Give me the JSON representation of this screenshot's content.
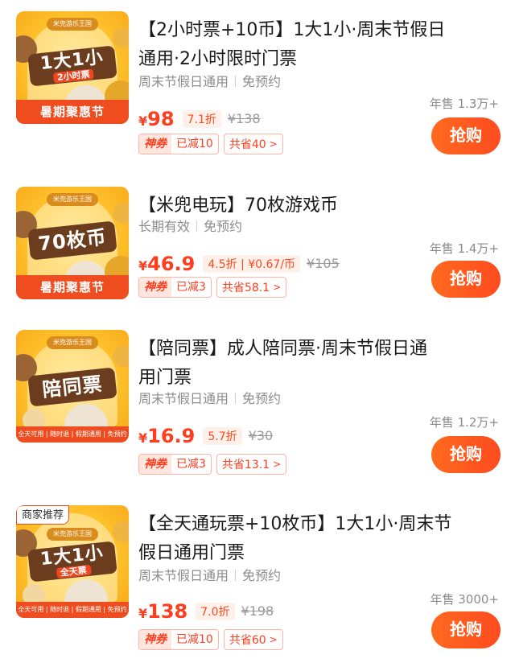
{
  "items": [
    {
      "thumb_park": "米兜游乐王国",
      "thumb_big": "1大1小",
      "thumb_sub": "2小时票",
      "thumb_ribbon": "暑期聚惠节",
      "title": "【2小时票+10币】1大1小·周末节假日\n通用·2小时限时门票",
      "validity": "周末节假日通用",
      "booking": "免预约",
      "currency": "¥",
      "price": "98",
      "discount": "7.1折",
      "original": "¥138",
      "coupon_tag": "神券",
      "coupon_amount": "已减10",
      "saving": "共省40",
      "sales": "年售 1.3万+",
      "buy": "抢购"
    },
    {
      "thumb_park": "米兜游乐王国",
      "thumb_big": "70枚币",
      "thumb_ribbon": "暑期聚惠节",
      "title": "【米兜电玩】70枚游戏币",
      "validity": "长期有效",
      "booking": "免预约",
      "currency": "¥",
      "price": "46.9",
      "discount": "4.5折 | ¥0.67/币",
      "original": "¥105",
      "coupon_tag": "神券",
      "coupon_amount": "已减3",
      "saving": "共省58.1",
      "sales": "年售 1.4万+",
      "buy": "抢购"
    },
    {
      "thumb_park": "米兜游乐王国",
      "thumb_big": "陪同票",
      "thumb_ribbon": "全天可用 | 随时退 | 假期通用 | 免预约",
      "title": "【陪同票】成人陪同票·周末节假日通\n用门票",
      "validity": "周末节假日通用",
      "booking": "免预约",
      "currency": "¥",
      "price": "16.9",
      "discount": "5.7折",
      "original": "¥30",
      "coupon_tag": "神券",
      "coupon_amount": "已减3",
      "saving": "共省13.1",
      "sales": "年售 1.2万+",
      "buy": "抢购"
    },
    {
      "merchant_tag": "商家推荐",
      "thumb_park": "米兜游乐王国",
      "thumb_big": "1大1小",
      "thumb_sub": "全天票",
      "thumb_ribbon": "全天可用 | 随时退 | 假期通用 | 免预约",
      "title": "【全天通玩票+10枚币】1大1小·周末节\n假日通用门票",
      "validity": "周末节假日通用",
      "booking": "免预约",
      "currency": "¥",
      "price": "138",
      "discount": "7.0折",
      "original": "¥198",
      "coupon_tag": "神券",
      "coupon_amount": "已减10",
      "saving": "共省60",
      "sales": "年售 3000+",
      "buy": "抢购"
    }
  ],
  "colors": {
    "accent": "#ff3d1f",
    "button": "#ff5a1f",
    "muted": "#8c8c8c"
  }
}
